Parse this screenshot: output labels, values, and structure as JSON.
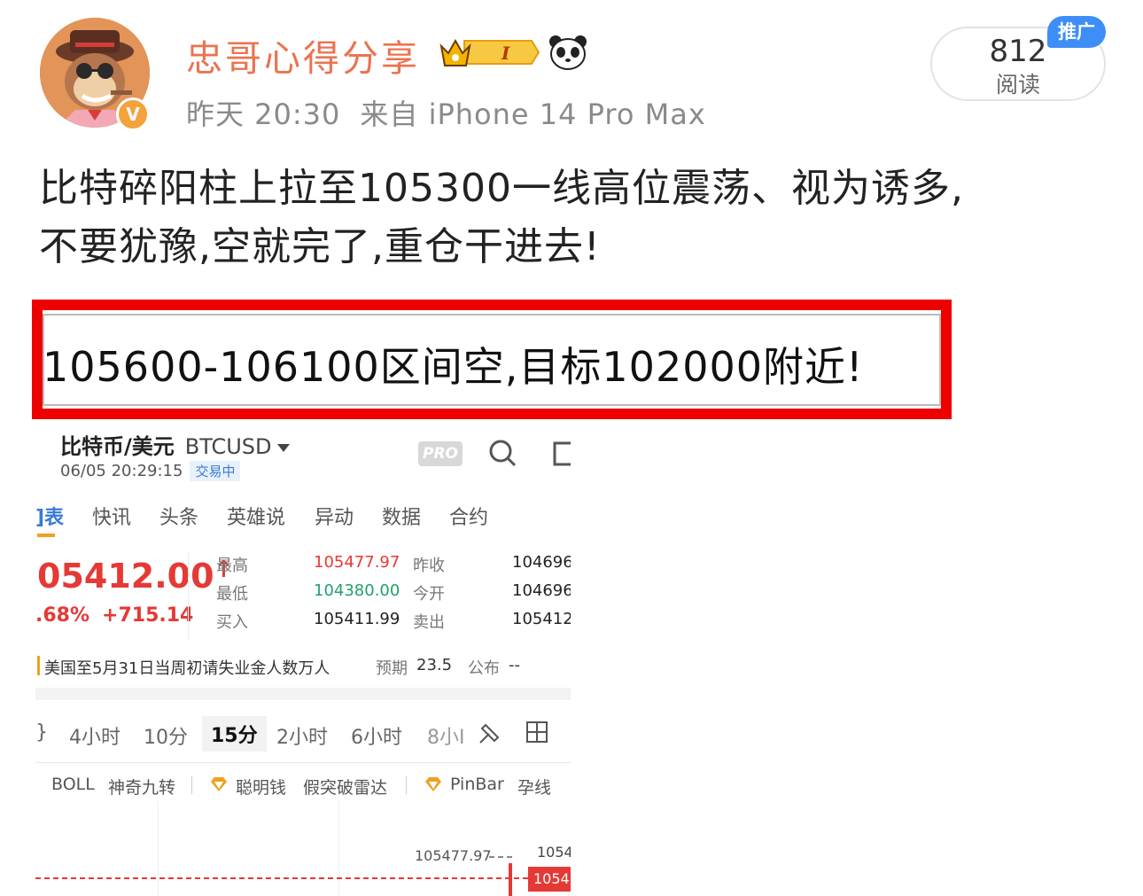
{
  "post": {
    "author": "忠哥心得分享",
    "level_badge": "I",
    "verified_badge": "V",
    "time": "昨天 20:30",
    "source": "来自 iPhone 14 Pro Max",
    "read_count": "812",
    "read_label": "阅读",
    "promo_badge": "推广",
    "text_line1": "比特碎阳柱上拉至105300一线高位震荡、视为诱多,",
    "text_line2": "不要犹豫,空就完了,重仓干进去!",
    "highlight_text": "105600-106100区间空,目标102000附近!"
  },
  "quote": {
    "title": "比特币/美元",
    "symbol": "BTCUSD",
    "datetime": "06/05 20:29:15",
    "status": "交易中",
    "pro_label": "PRO",
    "tabs": [
      "]表",
      "快讯",
      "头条",
      "英雄说",
      "异动",
      "数据",
      "合约"
    ],
    "price": "05412.00",
    "price_arrow": "↑",
    "change_pct": ".68%",
    "change_abs": "+715.14",
    "stats": [
      {
        "label": "最高",
        "value": "105477.97",
        "trend": "up"
      },
      {
        "label": "最低",
        "value": "104380.00",
        "trend": "down"
      },
      {
        "label": "买入",
        "value": "105411.99",
        "trend": "flat"
      }
    ],
    "stats_right": [
      {
        "label": "昨收",
        "value": "104696."
      },
      {
        "label": "今开",
        "value": "104696."
      },
      {
        "label": "卖出",
        "value": "105412."
      }
    ],
    "news": {
      "text": "美国至5月31日当周初请失业金人数万人",
      "expect_label": "预期",
      "expect_value": "23.5",
      "publish_label": "公布",
      "publish_value": "--"
    },
    "intervals": [
      "}",
      "4小时",
      "10分",
      "15分",
      "2小时",
      "6小时",
      "8小I"
    ],
    "active_interval": "15分",
    "indicators": [
      "BOLL",
      "神奇九转",
      "聪明钱",
      "假突破雷达",
      "PinBar",
      "孕线"
    ],
    "chart": {
      "high_label": "105477.97",
      "right_label": "1054",
      "current_tag": "1054"
    },
    "colors": {
      "up": "#e53935",
      "down": "#22a06b",
      "accent": "#3a7bd5",
      "highlight_border": "#ee0000"
    }
  }
}
